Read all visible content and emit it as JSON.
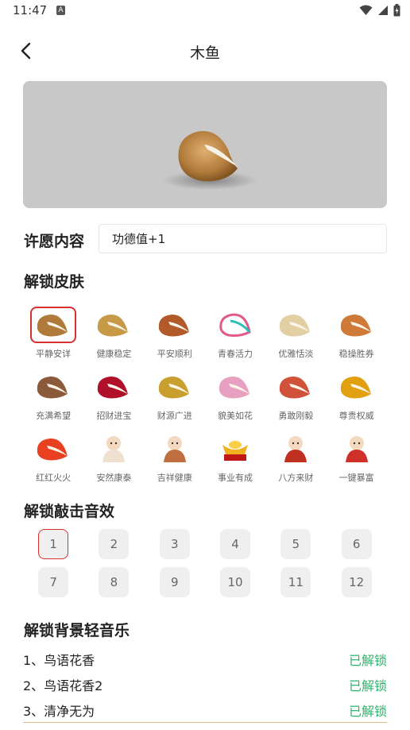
{
  "status_bar": {
    "time": "11:47",
    "notification_glyph": "A"
  },
  "header": {
    "title": "木鱼"
  },
  "wish": {
    "label": "许愿内容",
    "value": "功德值+1"
  },
  "skins": {
    "title": "解锁皮肤",
    "items": [
      {
        "label": "平静安详",
        "icon": "wooden-fish-classic",
        "color": "#b07a3a",
        "selected": true
      },
      {
        "label": "健康稳定",
        "icon": "wooden-fish-gold",
        "color": "#c79a48"
      },
      {
        "label": "平安顺利",
        "icon": "wooden-fish-red-brown",
        "color": "#b35a2a"
      },
      {
        "label": "青春活力",
        "icon": "wooden-fish-outline-pink-teal",
        "color": "#e05a8a"
      },
      {
        "label": "优雅恬淡",
        "icon": "wooden-fish-cream",
        "color": "#e2cfa4"
      },
      {
        "label": "稳操胜券",
        "icon": "wooden-fish-orange-wood",
        "color": "#d07a3a"
      },
      {
        "label": "充满希望",
        "icon": "wooden-fish-dark-wood",
        "color": "#8a5a3a"
      },
      {
        "label": "招财进宝",
        "icon": "wooden-fish-crimson",
        "color": "#b0102a"
      },
      {
        "label": "财源广进",
        "icon": "wooden-fish-gold-glitter",
        "color": "#c9a030"
      },
      {
        "label": "貌美如花",
        "icon": "wooden-fish-pink-flower",
        "color": "#e8a0c0"
      },
      {
        "label": "勇敢刚毅",
        "icon": "wooden-fish-coral",
        "color": "#d0523a"
      },
      {
        "label": "尊贵权威",
        "icon": "wooden-fish-black-gold",
        "color": "#e0a010"
      },
      {
        "label": "红红火火",
        "icon": "wooden-fish-fire",
        "color": "#e84020"
      },
      {
        "label": "安然康泰",
        "icon": "cartoon-monk-icon",
        "color": "#f0e0d0"
      },
      {
        "label": "吉祥健康",
        "icon": "sitting-monk-icon",
        "color": "#c07040"
      },
      {
        "label": "事业有成",
        "icon": "gold-ingot-icon",
        "color": "#f0b020"
      },
      {
        "label": "八方来财",
        "icon": "god-of-wealth-icon",
        "color": "#c03020"
      },
      {
        "label": "一键暴富",
        "icon": "wealth-deity-icon",
        "color": "#d0302a"
      }
    ]
  },
  "sounds": {
    "title": "解锁敲击音效",
    "items": [
      "1",
      "2",
      "3",
      "4",
      "5",
      "6",
      "7",
      "8",
      "9",
      "10",
      "11",
      "12"
    ],
    "selected": "1"
  },
  "music": {
    "title": "解锁背景轻音乐",
    "items": [
      {
        "name": "1、鸟语花香",
        "status": "已解锁"
      },
      {
        "name": "2、鸟语花香2",
        "status": "已解锁"
      },
      {
        "name": "3、清净无为",
        "status": "已解锁"
      }
    ]
  },
  "colors": {
    "accent_red": "#d93030",
    "unlocked_green": "#2db36a"
  }
}
